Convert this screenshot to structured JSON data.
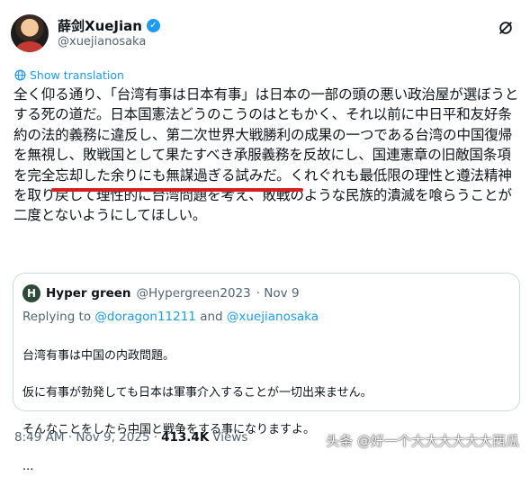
{
  "author": {
    "display_name": "薛剑XueJian",
    "handle": "@xuejianosaka",
    "verified_color": "#1d9bf0"
  },
  "show_translation": "Show translation",
  "tweet_text": "全く仰る通り、「台湾有事は日本有事」は日本の一部の頭の悪い政治屋が選ぼうとする死の道だ。日本国憲法どうのこうのはともかく、それ以前に中日平和友好条約の法的義務に違反し、第二次世界大戦勝利の成果の一つである台湾の中国復帰を無視し、敗戦国として果たすべき承服義務を反故にし、国連憲章の旧敵国条項を完全忘却した余りにも無謀過ぎる試みだ。くれぐれも最低限の理性と遵法精神を取り戻して理性的に台湾問題を考え、敗戦のような民族的潰滅を喰らうことが二度とないようにしてほしい。",
  "quoted": {
    "avatar_letter": "H",
    "name": "Hyper green",
    "handle": "@Hypergreen2023",
    "date": "· Nov 9",
    "replying_prefix": "Replying to",
    "replying_to_1": "@doragon11211",
    "replying_and": "and",
    "replying_to_2": "@xuejianosaka",
    "lines": [
      "台湾有事は中国の内政問題。",
      "仮に有事が勃発しても日本は軍事介入することが一切出来ません。",
      "そんなことをしたら中国と戦争をする事になりますよ。",
      "..."
    ]
  },
  "footer": {
    "time": "8:49 AM · Nov 9, 2025 ·",
    "views_count": "413.4K",
    "views_label": "Views"
  },
  "watermark": "头条 @好一个大大大大大大西瓜",
  "accent_color": "#1d9bf0",
  "underline_color": "#d61f1f",
  "icons": [
    "verified-badge-icon",
    "grok-icon",
    "globe-icon"
  ]
}
